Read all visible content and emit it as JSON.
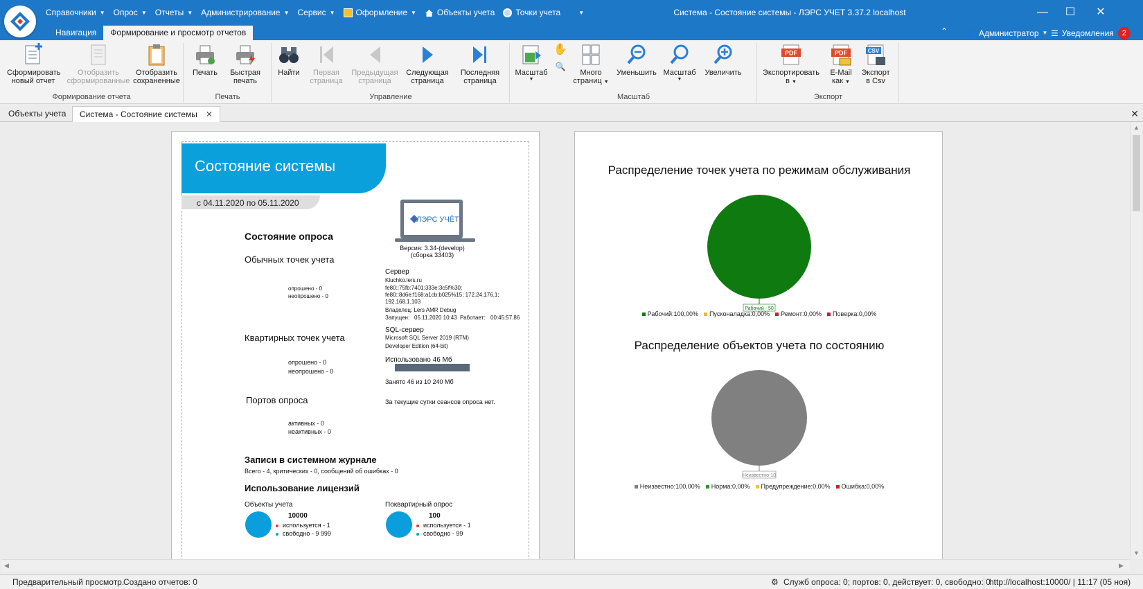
{
  "titlebar": {
    "menu": [
      {
        "label": "Справочники"
      },
      {
        "label": "Опрос"
      },
      {
        "label": "Отчеты"
      },
      {
        "label": "Администрирование"
      },
      {
        "label": "Сервис"
      },
      {
        "label": "Оформление"
      },
      {
        "label": "Объекты учета"
      },
      {
        "label": "Точки учета"
      }
    ],
    "window_title": "Система - Состояние системы - ЛЭРС УЧЕТ 3.37.2 localhost",
    "ribbon_tabs": [
      "Навигация",
      "Формирование и просмотр отчетов"
    ],
    "user": "Администратор",
    "notifications_label": "Уведомления",
    "notifications_count": "2"
  },
  "ribbon": {
    "groups": {
      "report": "Формирование отчета",
      "print": "Печать",
      "control": "Управление",
      "scale": "Масштаб",
      "export": "Экспорт"
    },
    "buttons": {
      "new_report": [
        "Сформировать",
        "новый отчет"
      ],
      "show_formed": [
        "Отобразить",
        "сформированные"
      ],
      "show_saved": [
        "Отобразить",
        "сохраненные"
      ],
      "print": [
        "Печать"
      ],
      "quick_print": [
        "Быстрая",
        "печать"
      ],
      "find": [
        "Найти"
      ],
      "first_page": [
        "Первая",
        "страница"
      ],
      "prev_page": [
        "Предыдущая",
        "страница"
      ],
      "next_page": [
        "Следующая",
        "страница"
      ],
      "last_page": [
        "Последняя",
        "страница"
      ],
      "scale_dd": [
        "Масштаб"
      ],
      "many_pages": [
        "Много",
        "страниц"
      ],
      "zoom_out": [
        "Уменьшить"
      ],
      "scale": [
        "Масштаб"
      ],
      "zoom_in": [
        "Увеличить"
      ],
      "export_to": [
        "Экспортировать",
        "в"
      ],
      "email_as": [
        "E-Mail",
        "как"
      ],
      "export_csv": [
        "Экспорт",
        "в Csv"
      ]
    },
    "icon_text": {
      "pdf": "PDF",
      "csv": "CSV"
    }
  },
  "doc_tabs": [
    "Объекты учета",
    "Система - Состояние системы"
  ],
  "report": {
    "title": "Состояние системы",
    "period": "с 04.11.2020 по 05.11.2020",
    "logo_text": "ЛЭРС УЧЁТ",
    "version": "Версия:  3.34-(develop)",
    "build": "(сборка 33403)",
    "poll_status": "Состояние опроса",
    "regular_points": "Обычных точек учета",
    "regular_polled": "опрошено - 0",
    "regular_unpolled": "неопрошено - 0",
    "server_label": "Сервер",
    "server_lines": [
      "Kluchko.lers.ru",
      "fe80::75fb:7401:333e:3c5f%30;",
      "fe80::8d6e:f168:a1cb:b025%15;  172.24.176.1;",
      "192.168.1.103",
      "Владелец:  Lers AMR Debug"
    ],
    "started_label": "Запущен:",
    "started_value": "05.11.2020 10:43",
    "works_label": "Работает:",
    "works_value": "00:45:57.86",
    "apartment_points": "Квартирных точек учета",
    "apartment_polled": "опрошено - 0",
    "apartment_unpolled": "неопрошено - 0",
    "sql_label": "SQL-сервер",
    "sql_lines": [
      "Microsoft SQL Server 2019 (RTM)",
      "Developer Edition (64-bit)"
    ],
    "used_label": "Использовано 46 Мб",
    "occupied_label": "Занято 46 из 10 240 Мб",
    "ports": "Портов опроса",
    "ports_active": "активных - 0",
    "ports_inactive": "неактивных - 0",
    "sessions_note": "За текущие сутки сеансов опроса нет.",
    "journal_title": "Записи в системном журнале",
    "journal_summary": "Всего - 4, критических - 0, сообщений об ошибках - 0",
    "licenses_title": "Использование лицензий",
    "lic_objects": {
      "label": "Объекты учета",
      "total": "10000",
      "used": "используется - 1",
      "free": "свободно - 9 999"
    },
    "lic_apartment": {
      "label": "Поквартирный опрос",
      "total": "100",
      "used": "используется - 1",
      "free": "свободно - 99"
    }
  },
  "chart_data": [
    {
      "type": "pie",
      "title": "Распределение точек учета по режимам обслуживания",
      "categories": [
        "Рабочий",
        "Пусконаладка",
        "Ремонт",
        "Поверка"
      ],
      "values": [
        50,
        0,
        0,
        0
      ],
      "slice_label": "Рабочий - 50",
      "legend": [
        "Рабочий:100,00%",
        "Пусконаладка:0,00%",
        "Ремонт:0,00%",
        "Поверка:0,00%"
      ],
      "colors": [
        "#0f7a0f",
        "#e8c020",
        "#d02020",
        "#c02040"
      ]
    },
    {
      "type": "pie",
      "title": "Распределение объектов учета по состоянию",
      "categories": [
        "Неизвестно",
        "Норма",
        "Предупреждение",
        "Ошибка"
      ],
      "values": [
        10,
        0,
        0,
        0
      ],
      "slice_label": "Неизвестно-10",
      "legend": [
        "Неизвестно:100,00%",
        "Норма:0,00%",
        "Предупреждение:0,00%",
        "Ошибка:0,00%"
      ],
      "colors": [
        "#808080",
        "#20a020",
        "#e8d020",
        "#d02020"
      ]
    }
  ],
  "status": {
    "preview": "Предварительный просмотр.",
    "created": "Создано отчетов: 0",
    "services": "Служб опроса: 0; портов: 0, действует: 0, свободно: 0",
    "url_time": "http://localhost:10000/ | 11:17 (05 ноя)"
  },
  "colors": {
    "accent": "#1e78c8",
    "report_blue": "#0aa0dc"
  }
}
